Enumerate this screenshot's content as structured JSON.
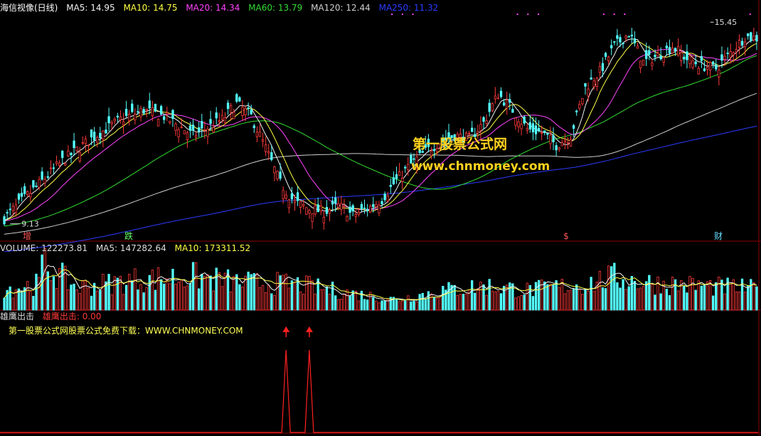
{
  "colors": {
    "up": "#ff3a3a",
    "down": "#54ffff",
    "ma5": "#f2f2f2",
    "ma10": "#ffff44",
    "ma20": "#ff44ff",
    "ma60": "#33dd33",
    "ma120": "#cfcfcf",
    "ma250": "#2b3bff",
    "divider": "#8a0000"
  },
  "price_panel": {
    "title": "海信视像(日线)",
    "indicators": [
      {
        "label": "MA5: 14.95",
        "color": "#f2f2f2"
      },
      {
        "label": "MA10: 14.75",
        "color": "#ffff44"
      },
      {
        "label": "MA20: 14.34",
        "color": "#ff44ff"
      },
      {
        "label": "MA60: 13.79",
        "color": "#33dd33"
      },
      {
        "label": "MA120: 12.44",
        "color": "#cfcfcf"
      },
      {
        "label": "MA250: 11.32",
        "color": "#2b3bff"
      }
    ],
    "high_label": "15.45",
    "low_label": "9.13",
    "markers": [
      {
        "text": "增",
        "color": "#ff5555"
      },
      {
        "text": "跌",
        "color": "#66ff66"
      },
      {
        "text": "$",
        "color": "#ff5555"
      },
      {
        "text": "财",
        "color": "#66ddff"
      }
    ]
  },
  "volume_panel": {
    "indicators": [
      {
        "label": "VOLUME: 122273.81",
        "color": "#dddddd"
      },
      {
        "label": "MA5: 147282.64",
        "color": "#dddddd"
      },
      {
        "label": "MA10: 173311.52",
        "color": "#ffff44"
      }
    ]
  },
  "signal_panel": {
    "title": "雄鹰出击",
    "value_label": "雄鹰出击: 0.00",
    "subtitle": "第一股票公式网股票公式免费下载：WWW.CHNMONEY.COM"
  },
  "watermark": {
    "line1": "第一股票公式网",
    "line2": "www.chnmoney.com"
  },
  "chart_data": [
    {
      "type": "candlestick",
      "title": "海信视像(日线)",
      "ylim": [
        8.9,
        15.7
      ],
      "high": 15.45,
      "low": 9.13,
      "anchors_close": [
        [
          0,
          9.3
        ],
        [
          10,
          10.2
        ],
        [
          20,
          11.1
        ],
        [
          30,
          11.8
        ],
        [
          40,
          12.4
        ],
        [
          48,
          12.7
        ],
        [
          55,
          12.5
        ],
        [
          65,
          11.9
        ],
        [
          75,
          12.4
        ],
        [
          80,
          12.9
        ],
        [
          85,
          12.5
        ],
        [
          90,
          11.5
        ],
        [
          95,
          10.4
        ],
        [
          100,
          9.8
        ],
        [
          105,
          9.6
        ],
        [
          110,
          9.5
        ],
        [
          115,
          9.7
        ],
        [
          120,
          9.4
        ],
        [
          125,
          9.6
        ],
        [
          130,
          9.9
        ],
        [
          135,
          10.5
        ],
        [
          140,
          11.0
        ],
        [
          145,
          11.4
        ],
        [
          150,
          11.7
        ],
        [
          155,
          11.9
        ],
        [
          160,
          11.8
        ],
        [
          165,
          12.3
        ],
        [
          170,
          13.2
        ],
        [
          175,
          12.7
        ],
        [
          180,
          12.1
        ],
        [
          185,
          12.0
        ],
        [
          190,
          11.6
        ],
        [
          195,
          11.9
        ],
        [
          200,
          13.4
        ],
        [
          205,
          13.9
        ],
        [
          210,
          14.7
        ],
        [
          215,
          15.1
        ],
        [
          220,
          14.2
        ],
        [
          225,
          14.4
        ],
        [
          230,
          14.7
        ],
        [
          235,
          14.3
        ],
        [
          240,
          14.1
        ],
        [
          245,
          14.0
        ],
        [
          250,
          14.5
        ],
        [
          255,
          15.0
        ],
        [
          259,
          14.95
        ]
      ],
      "ma_last": {
        "MA5": 14.95,
        "MA10": 14.75,
        "MA20": 14.34,
        "MA60": 13.79,
        "MA120": 12.44,
        "MA250": 11.32
      }
    },
    {
      "type": "bar",
      "title": "VOLUME",
      "last_volume": 122273.81,
      "ma5": 147282.64,
      "ma10": 173311.52,
      "ylim": [
        0,
        330000
      ],
      "anchors": [
        [
          0,
          120000
        ],
        [
          12,
          150000
        ],
        [
          13,
          270000
        ],
        [
          25,
          130000
        ],
        [
          45,
          175000
        ],
        [
          65,
          195000
        ],
        [
          80,
          160000
        ],
        [
          100,
          150000
        ],
        [
          120,
          95000
        ],
        [
          135,
          60000
        ],
        [
          150,
          110000
        ],
        [
          165,
          140000
        ],
        [
          180,
          115000
        ],
        [
          200,
          150000
        ],
        [
          210,
          190000
        ],
        [
          220,
          160000
        ],
        [
          240,
          140000
        ],
        [
          259,
          122000
        ]
      ]
    },
    {
      "type": "line",
      "title": "雄鹰出击",
      "value": 0.0,
      "signal_bars": [
        97,
        105
      ],
      "ylim": [
        0,
        1
      ]
    }
  ]
}
